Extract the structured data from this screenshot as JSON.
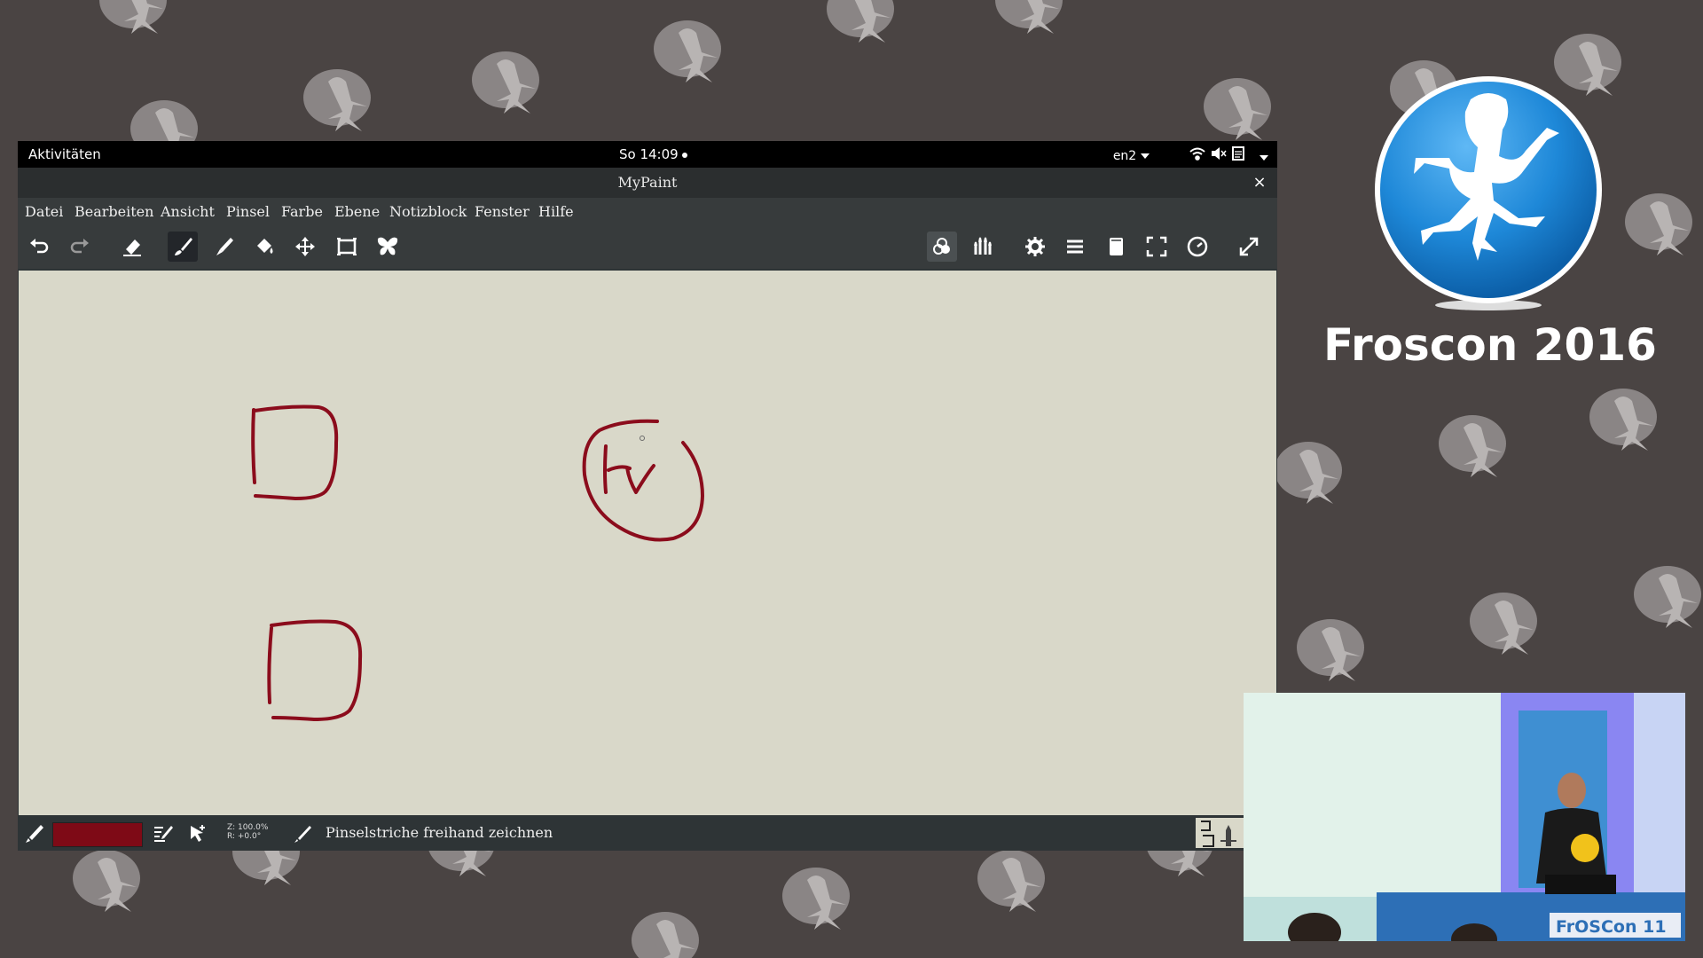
{
  "desktop": {
    "activities": "Aktivitäten",
    "clock": "So 14:09",
    "keyboard_layout": "en2"
  },
  "window": {
    "title": "MyPaint",
    "close_glyph": "×"
  },
  "menu": [
    "Datei",
    "Bearbeiten",
    "Ansicht",
    "Pinsel",
    "Farbe",
    "Ebene",
    "Notizblock",
    "Fenster",
    "Hilfe"
  ],
  "toolbar_left": [
    "undo-icon",
    "redo-icon",
    "eraser-icon",
    "brush-icon",
    "pen-icon",
    "fill-icon",
    "move-layer-icon",
    "frame-icon",
    "symmetry-butterfly-icon"
  ],
  "toolbar_right": [
    "color-wheel-icon",
    "brush-palette-icon",
    "settings-gear-icon",
    "layers-icon",
    "scratchpad-icon",
    "fullscreen-icon",
    "history-clock-icon",
    "expand-icon"
  ],
  "status": {
    "zoom": "Z: 100.0%",
    "rotation": "R: +0.0°",
    "message": "Pinselstriche freihand zeichnen",
    "brush_color": "#7e0a16"
  },
  "event": {
    "title": "Froscon 2016",
    "video_banner": "FrOSCon 11"
  },
  "colors": {
    "background": "#4a4443",
    "canvas": "#d9d8c9",
    "stroke": "#8b0c1c",
    "logo_blue": "#1e88d8"
  }
}
